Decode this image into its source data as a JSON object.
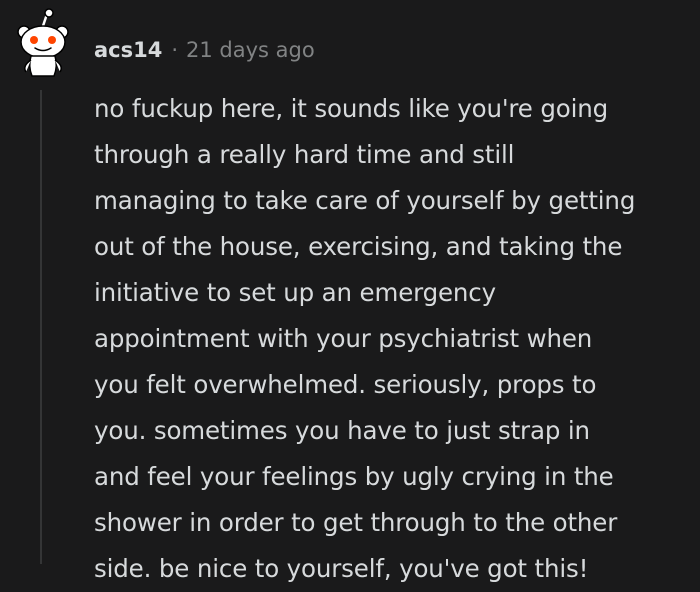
{
  "comment": {
    "username": "acs14",
    "separator": "·",
    "timestamp": "21 days ago",
    "avatar_icon": "snoo-avatar-icon",
    "body_lines": [
      "no fuckup here, it sounds like you're going",
      "through a really hard time and still",
      "managing to take care of yourself by getting",
      "out of the house, exercising, and taking the",
      "initiative to set up an emergency",
      "appointment with your psychiatrist when",
      "you felt overwhelmed. seriously, props to",
      "you. sometimes you have to just strap in",
      "and feel your feelings by ugly crying in the",
      "shower in order to get through to the other",
      "side. be nice to yourself, you've got this!"
    ]
  },
  "colors": {
    "background": "#1a1a1b",
    "text": "#d7dadc",
    "muted": "#818384",
    "thread_line": "#343536",
    "snoo_eye": "#ff4500"
  }
}
